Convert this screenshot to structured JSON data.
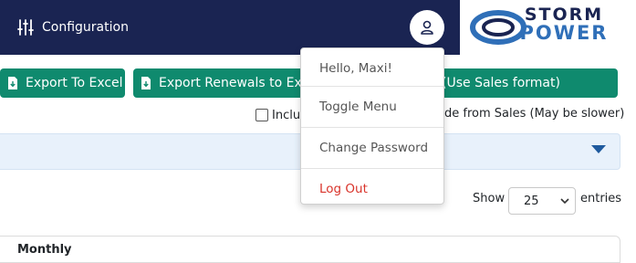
{
  "header": {
    "config_label": "Configuration",
    "config_icon": "sliders-icon",
    "user_icon": "user-icon",
    "logo": {
      "line1": "STORM",
      "line2": "POWER"
    }
  },
  "toolbar": {
    "export_excel": "Export To Excel",
    "export_renewals": "Export Renewals to Excel",
    "export_sales_format": "Export To Excel (Use Sales format)",
    "button_icon": "file-download-icon"
  },
  "options": {
    "include_label_start": "Inclu",
    "include_label_end": "de from Sales (May be slower)"
  },
  "table": {
    "show_label": "Show",
    "page_size": "25",
    "entries_label": "entries",
    "section_title": "Monthly"
  },
  "user_menu": {
    "greeting": "Hello, Maxi!",
    "items": [
      "Toggle Menu",
      "Change Password",
      "Log Out"
    ]
  },
  "colors": {
    "header_bg": "#1a2452",
    "button_bg": "#0f8a6e",
    "logout": "#d9342b",
    "filter_bg": "#e8f1fb"
  }
}
